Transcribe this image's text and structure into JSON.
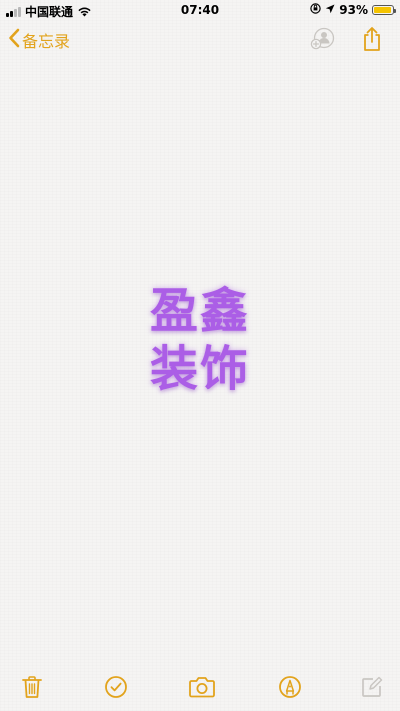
{
  "status_bar": {
    "carrier": "中国联通",
    "time": "07:40",
    "battery_percent": "93%",
    "battery_level": 0.93,
    "signal_bars_filled": 2
  },
  "nav": {
    "back_label": "备忘录",
    "accent_color": "#e2a31c"
  },
  "note": {
    "line1": "盈鑫",
    "line2": "装饰",
    "text_color": "#ab5ee6"
  },
  "toolbar": {
    "icons": [
      "trash-icon",
      "checklist-icon",
      "camera-icon",
      "markup-icon",
      "compose-icon"
    ]
  }
}
